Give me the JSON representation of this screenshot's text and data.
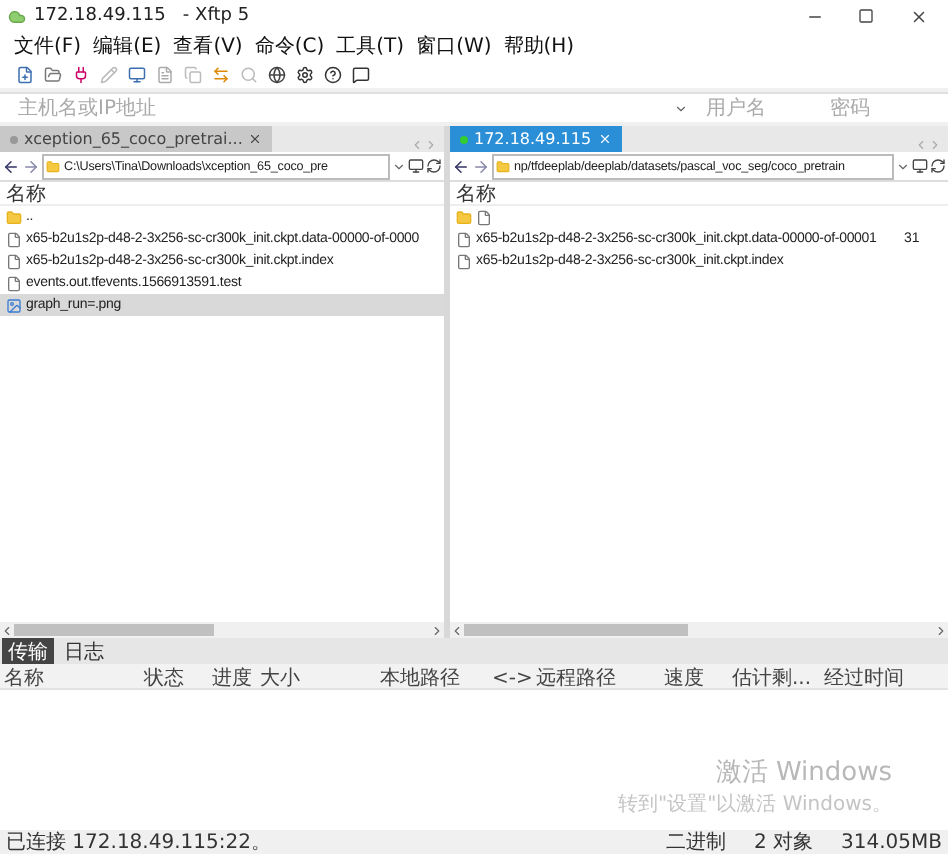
{
  "window": {
    "title": "172.18.49.115   - Xftp 5"
  },
  "menu": [
    "文件(F)",
    "编辑(E)",
    "查看(V)",
    "命令(C)",
    "工具(T)",
    "窗口(W)",
    "帮助(H)"
  ],
  "address_bar": {
    "placeholder": "主机名或IP地址",
    "user_placeholder": "用户名",
    "password_placeholder": "密码"
  },
  "panes": [
    {
      "tab": {
        "label": "xception_65_coco_pretrai...",
        "selected": false
      },
      "path": "C:\\Users\\Tina\\Downloads\\xception_65_coco_pre",
      "column": "名称",
      "files": [
        {
          "kind": "folder",
          "name": "..",
          "selected": false
        },
        {
          "kind": "file",
          "name": "x65-b2u1s2p-d48-2-3x256-sc-cr300k_init.ckpt.data-00000-of-0000",
          "selected": false
        },
        {
          "kind": "file",
          "name": "x65-b2u1s2p-d48-2-3x256-sc-cr300k_init.ckpt.index",
          "selected": false
        },
        {
          "kind": "file",
          "name": "events.out.tfevents.1566913591.test",
          "selected": false
        },
        {
          "kind": "image",
          "name": "graph_run=.png",
          "selected": true
        }
      ]
    },
    {
      "tab": {
        "label": "172.18.49.115",
        "selected": true
      },
      "path": "np/tfdeeplab/deeplab/datasets/pascal_voc_seg/coco_pretrain",
      "column": "名称",
      "files": [
        {
          "kind": "parent",
          "selected": false
        },
        {
          "kind": "file",
          "name": "x65-b2u1s2p-d48-2-3x256-sc-cr300k_init.ckpt.data-00000-of-00001",
          "column_2": "31",
          "selected": false
        },
        {
          "kind": "file",
          "name": "x65-b2u1s2p-d48-2-3x256-sc-cr300k_init.ckpt.index",
          "selected": false
        }
      ]
    }
  ],
  "transfer": {
    "tabs": [
      {
        "label": "传输",
        "selected": true
      },
      {
        "label": "日志",
        "selected": false
      }
    ],
    "columns": [
      "名称",
      "状态",
      "进度",
      "大小",
      "本地路径",
      "<->",
      "远程路径",
      "速度",
      "估计剩...",
      "经过时间"
    ]
  },
  "activation_notice": {
    "title": "激活 Windows",
    "text": "转到\"设置\"以激活 Windows。"
  },
  "status_bar": {
    "connection": "已连接 172.18.49.115:22。",
    "mode": "二进制",
    "objects": "2 对象",
    "size": "314.05MB"
  }
}
